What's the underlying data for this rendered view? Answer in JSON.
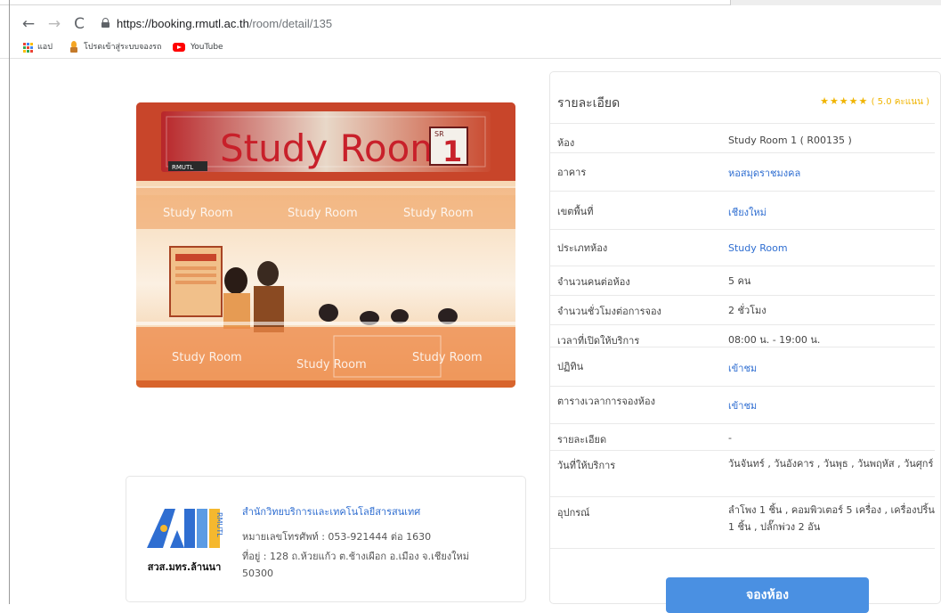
{
  "browser": {
    "url_host": "https://booking.rmutl.ac.th",
    "url_path": "/room/detail/135",
    "bookmarks": [
      "แอป",
      "โปรดเข้าสู่ระบบจองรถ",
      "YouTube"
    ]
  },
  "photo": {
    "sign_text": "Study Room",
    "sign_badge_top": "SR",
    "sign_badge_num": "1",
    "sign_brand": "RMUTL",
    "window_text": "Study Room"
  },
  "contact": {
    "logo_text": "สวส.มทร.ล้านนา",
    "logo_side": "RMUTL",
    "org_name": "สำนักวิทยบริการและเทคโนโลยีสารสนเทศ",
    "phone": "หมายเลขโทรศัพท์ : 053-921444 ต่อ 1630",
    "address_line1": "ที่อยู่ : 128 ถ.ห้วยแก้ว ต.ช้างเผือก อ.เมือง จ.เชียงใหม่",
    "address_line2": "50300"
  },
  "details": {
    "title": "รายละเอียด",
    "stars": "★★★★★",
    "rating_text": "( 5.0 คะแนน )",
    "rows": [
      {
        "label": "ห้อง",
        "value": "Study Room 1 ( R00135 )"
      },
      {
        "label": "อาคาร",
        "value": "หอสมุดราชมงคล"
      },
      {
        "label": "เขตพื้นที่",
        "value": "เชียงใหม่"
      },
      {
        "label": "ประเภทห้อง",
        "value": "Study Room"
      },
      {
        "label": "จำนวนคนต่อห้อง",
        "value": "5 คน"
      },
      {
        "label": "จำนวนชั่วโมงต่อการจอง",
        "value": "2 ชั่วโมง"
      },
      {
        "label": "เวลาที่เปิดให้บริการ",
        "value": "08:00 น. - 19:00 น."
      },
      {
        "label": "ปฏิทิน",
        "value": "เข้าชม"
      },
      {
        "label": "ตารางเวลาการจองห้อง",
        "value": "เข้าชม"
      },
      {
        "label": "รายละเอียด",
        "value": "-"
      },
      {
        "label": "วันที่ให้บริการ",
        "value": "วันจันทร์ , วันอังคาร , วันพุธ , วันพฤหัส , วันศุกร์"
      },
      {
        "label": "อุปกรณ์",
        "value": "ลำโพง 1 ชิ้น , คอมพิวเตอร์ 5 เครื่อง , เครื่องปริ้น 1 ชิ้น , ปลั๊กพ่วง 2 อัน"
      }
    ],
    "book_button": "จองห้อง"
  }
}
